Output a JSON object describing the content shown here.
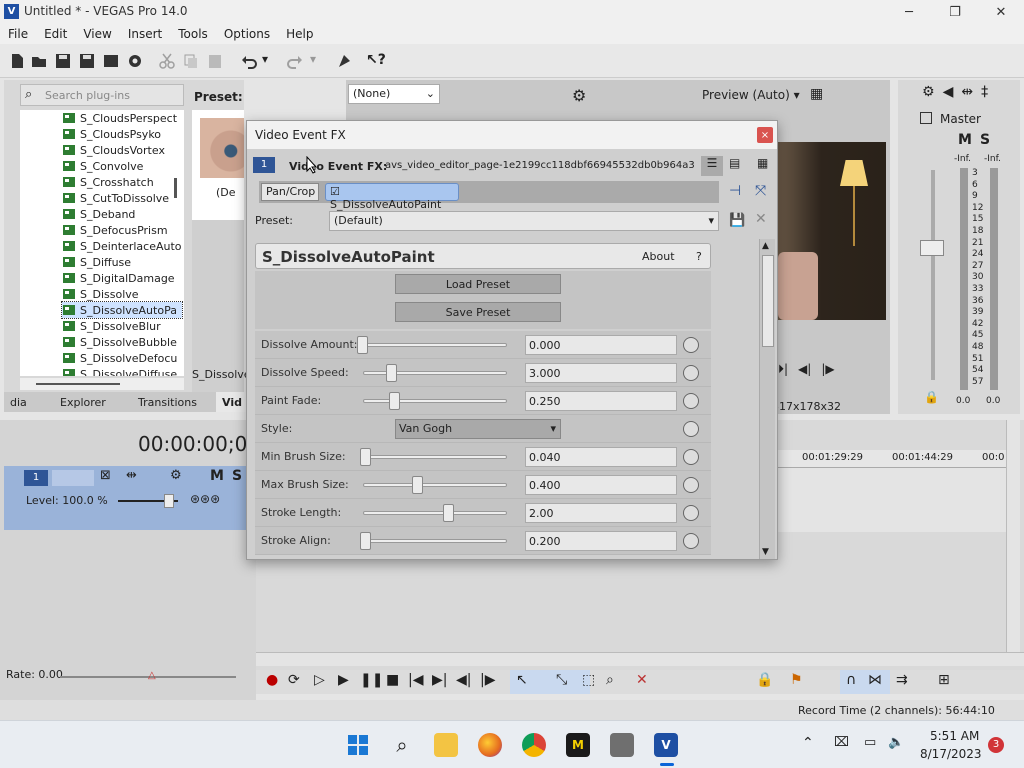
{
  "window": {
    "title": "Untitled * - VEGAS Pro 14.0"
  },
  "menu": [
    "File",
    "Edit",
    "View",
    "Insert",
    "Tools",
    "Options",
    "Help"
  ],
  "plugins": {
    "search_placeholder": "Search plug-ins",
    "preset_label": "Preset:",
    "preset_thumb_caption": "(De",
    "items": [
      "S_CloudsPerspect",
      "S_CloudsPsyko",
      "S_CloudsVortex",
      "S_Convolve",
      "S_Crosshatch",
      "S_CutToDissolve",
      "S_Deband",
      "S_DefocusPrism",
      "S_DeinterlaceAuto",
      "S_Diffuse",
      "S_DigitalDamage",
      "S_Dissolve",
      "S_DissolveAutoPa",
      "S_DissolveBlur",
      "S_DissolveBubble",
      "S_DissolveDefocu",
      "S_DissolveDiffuse"
    ],
    "selected_index": 12,
    "bottom_caption": "S_Dissolve"
  },
  "tabs": [
    "dia",
    "Explorer",
    "Transitions",
    "Vid"
  ],
  "preview": {
    "none_select": "(None)",
    "mode": "Preview (Auto)",
    "resolution": "317x178x32"
  },
  "master": {
    "title": "Master",
    "m": "M",
    "s": "S",
    "inf_left": "-Inf.",
    "inf_right": "-Inf.",
    "scale": [
      "3",
      "6",
      "9",
      "12",
      "15",
      "18",
      "21",
      "24",
      "27",
      "30",
      "33",
      "36",
      "39",
      "42",
      "45",
      "48",
      "51",
      "54",
      "57"
    ],
    "value_left": "0.0",
    "value_right": "0.0"
  },
  "timeline": {
    "timecode": "00:00:00;00",
    "track_number": "1",
    "level": "Level: 100.0 %",
    "m": "M",
    "s": "S",
    "ruler": [
      "00:01:29:29",
      "00:01:44:29",
      "00:0"
    ],
    "rate": "Rate: 0.00",
    "record_time": "Record Time (2 channels): 56:44:10"
  },
  "dialog": {
    "title": "Video Event FX",
    "close": "×",
    "track_badge": "1",
    "fx_label": "Video Event FX:",
    "fx_file": "avs_video_editor_page-1e2199cc118dbf66945532db0b964a3",
    "chain": [
      "Pan/Crop",
      "S_DissolveAutoPaint"
    ],
    "preset_label": "Preset:",
    "preset_value": "(Default)",
    "plugin_title": "S_DissolveAutoPaint",
    "about": "About",
    "help": "?",
    "load_preset": "Load Preset",
    "save_preset": "Save Preset",
    "params": [
      {
        "label": "Dissolve Amount:",
        "value": "0.000",
        "pos": 0.0
      },
      {
        "label": "Dissolve Speed:",
        "value": "3.000",
        "pos": 0.2
      },
      {
        "label": "Paint Fade:",
        "value": "0.250",
        "pos": 0.22
      },
      {
        "label": "Style:",
        "value": "Van Gogh",
        "type": "select"
      },
      {
        "label": "Min Brush Size:",
        "value": "0.040",
        "pos": 0.02
      },
      {
        "label": "Max Brush Size:",
        "value": "0.400",
        "pos": 0.38
      },
      {
        "label": "Stroke Length:",
        "value": "2.00",
        "pos": 0.6
      },
      {
        "label": "Stroke Align:",
        "value": "0.200",
        "pos": 0.02
      }
    ]
  },
  "clock": {
    "time": "5:51 AM",
    "date": "8/17/2023",
    "badge": "3"
  },
  "colors": {
    "accent": "#0a64d8",
    "selection": "#cfe3ff",
    "track_header": "#9ab3d9"
  }
}
